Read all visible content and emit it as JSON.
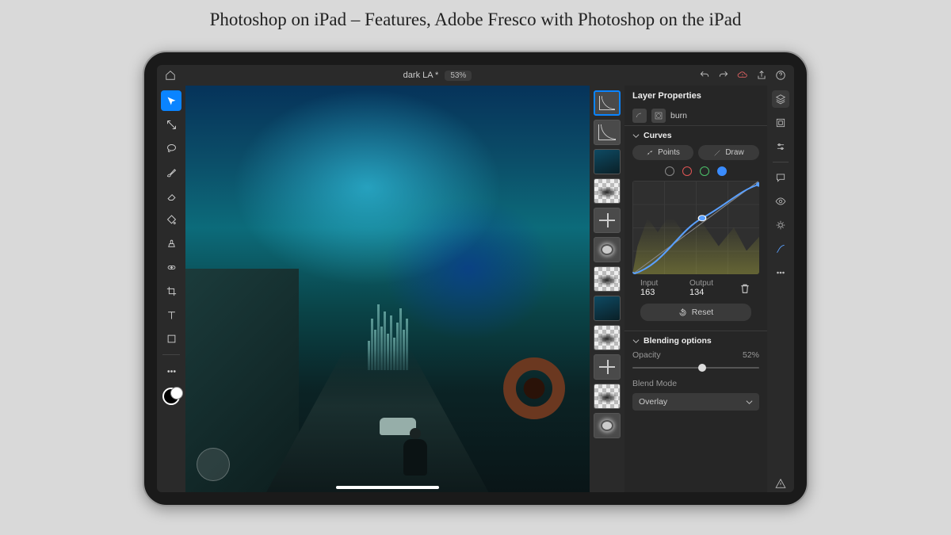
{
  "page_title": "Photoshop on iPad – Features, Adobe Fresco with Photoshop on the iPad",
  "topbar": {
    "document_name": "dark LA *",
    "zoom": "53%"
  },
  "properties": {
    "panel_title": "Layer Properties",
    "layer_name": "burn",
    "curves": {
      "section": "Curves",
      "points_btn": "Points",
      "draw_btn": "Draw",
      "channels": [
        "white",
        "red",
        "green",
        "blue"
      ],
      "active_channel": "blue",
      "input_label": "Input",
      "output_label": "Output",
      "input_value": "163",
      "output_value": "134",
      "reset": "Reset"
    },
    "blending": {
      "section": "Blending options",
      "opacity_label": "Opacity",
      "opacity_value": "52%",
      "opacity_pct": 52,
      "blendmode_label": "Blend Mode",
      "blendmode_value": "Overlay"
    }
  },
  "tools": [
    "move",
    "transform",
    "lasso",
    "brush",
    "eraser",
    "fill",
    "clone",
    "heal",
    "crop",
    "type",
    "shape"
  ],
  "layer_thumbs": [
    "curve",
    "curve",
    "img",
    "checker",
    "scale",
    "bright",
    "checker",
    "img",
    "checker",
    "scale",
    "checker",
    "bright"
  ],
  "right_rail": [
    "layers",
    "properties",
    "adjust",
    "sep",
    "comment",
    "eye",
    "effects",
    "curves",
    "more",
    "sep2",
    "warn"
  ],
  "colors": {
    "accent": "#0a84ff",
    "bg": "#262626",
    "panel": "#2a2a2a"
  }
}
